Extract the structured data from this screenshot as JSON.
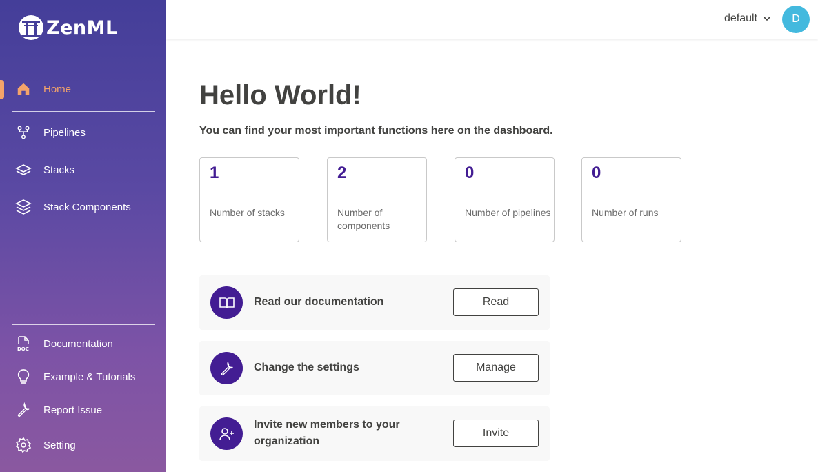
{
  "brand": {
    "name": "ZenML"
  },
  "sidebar": {
    "items": [
      {
        "label": "Home",
        "icon": "home-icon",
        "active": true
      },
      {
        "label": "Pipelines",
        "icon": "pipelines-icon"
      },
      {
        "label": "Stacks",
        "icon": "stacks-icon"
      },
      {
        "label": "Stack Components",
        "icon": "stack-components-icon"
      }
    ],
    "bottom_items": [
      {
        "label": "Documentation",
        "icon": "doc-icon"
      },
      {
        "label": "Example & Tutorials",
        "icon": "lightbulb-icon"
      },
      {
        "label": "Report Issue",
        "icon": "wrench-icon"
      },
      {
        "label": "Setting",
        "icon": "gear-icon"
      }
    ],
    "accent_color": "#f4a46a"
  },
  "header": {
    "workspace": "default",
    "avatar_initial": "D",
    "avatar_color": "#43b9de"
  },
  "main": {
    "title": "Hello World!",
    "subtitle": "You can find your most important functions here on the dashboard.",
    "stats": [
      {
        "value": "1",
        "label": "Number of stacks"
      },
      {
        "value": "2",
        "label": "Number of components"
      },
      {
        "value": "0",
        "label": "Number of pipelines"
      },
      {
        "value": "0",
        "label": "Number of runs"
      }
    ],
    "actions": [
      {
        "text": "Read our documentation",
        "button": "Read",
        "icon": "book-icon"
      },
      {
        "text": "Change the settings",
        "button": "Manage",
        "icon": "wrench-icon"
      },
      {
        "text": "Invite new members to your organization",
        "button": "Invite",
        "icon": "add-user-icon"
      }
    ],
    "primary_color": "#431d93"
  }
}
